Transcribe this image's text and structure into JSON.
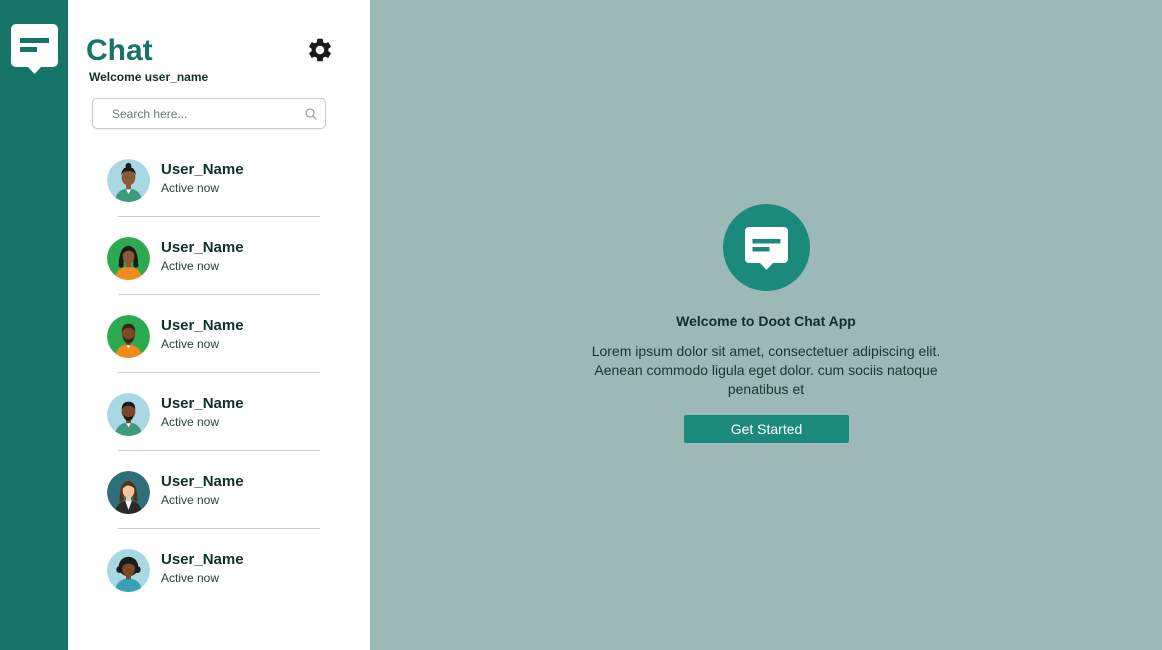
{
  "colors": {
    "rail": "#167567",
    "accent": "#1c8a7a",
    "main_bg": "#9cb8b7",
    "sidebar_bg": "#ffffff"
  },
  "rail": {
    "logo_icon": "chat-bubble-icon"
  },
  "sidebar": {
    "title": "Chat",
    "welcome": "Welcome user_name",
    "settings_icon": "gear-icon",
    "search": {
      "placeholder": "Search here...",
      "value": "",
      "icon": "search-icon"
    },
    "contacts": [
      {
        "name": "User_Name",
        "status": "Active now"
      },
      {
        "name": "User_Name",
        "status": "Active now"
      },
      {
        "name": "User_Name",
        "status": "Active now"
      },
      {
        "name": "User_Name",
        "status": "Active now"
      },
      {
        "name": "User_Name",
        "status": "Active now"
      },
      {
        "name": "User_Name",
        "status": "Active now"
      }
    ]
  },
  "main": {
    "title": "Welcome to Doot Chat App",
    "text": "Lorem ipsum dolor sit amet, consectetuer adipiscing elit. Aenean commodo ligula eget dolor. cum sociis natoque penatibus et",
    "button_label": "Get Started"
  }
}
